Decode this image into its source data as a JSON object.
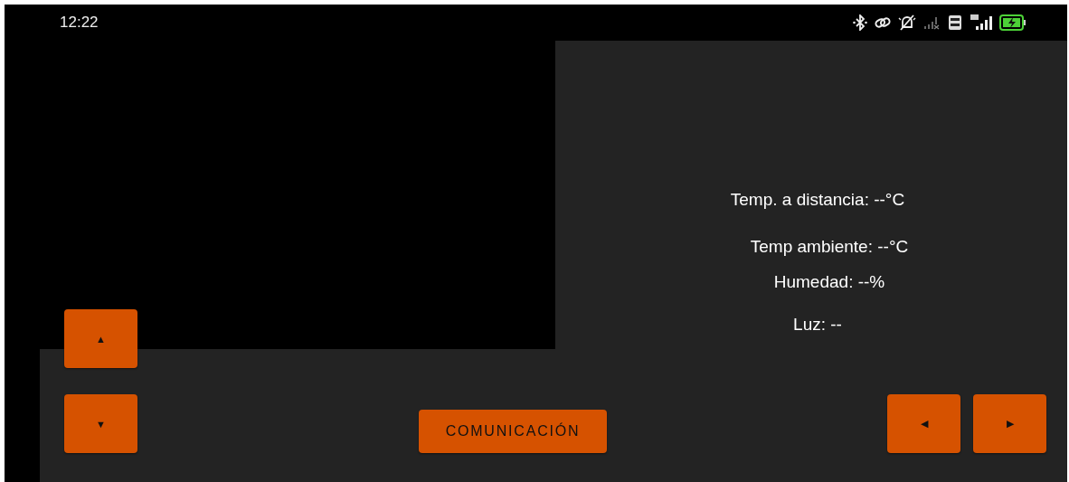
{
  "status_bar": {
    "time": "12:22"
  },
  "readings": [
    {
      "text": "Temp. a distancia: --°C"
    },
    {
      "text": "Temp ambiente: --°C"
    },
    {
      "text": "Humedad: --%"
    },
    {
      "text": "Luz: --"
    }
  ],
  "buttons": [
    {
      "kind": "up",
      "label": "▲"
    },
    {
      "kind": "down",
      "label": "▼"
    },
    {
      "kind": "wide",
      "label": "COMUNICACIÓN"
    },
    {
      "kind": "left",
      "label": "◀"
    },
    {
      "kind": "right",
      "label": "▶"
    }
  ]
}
